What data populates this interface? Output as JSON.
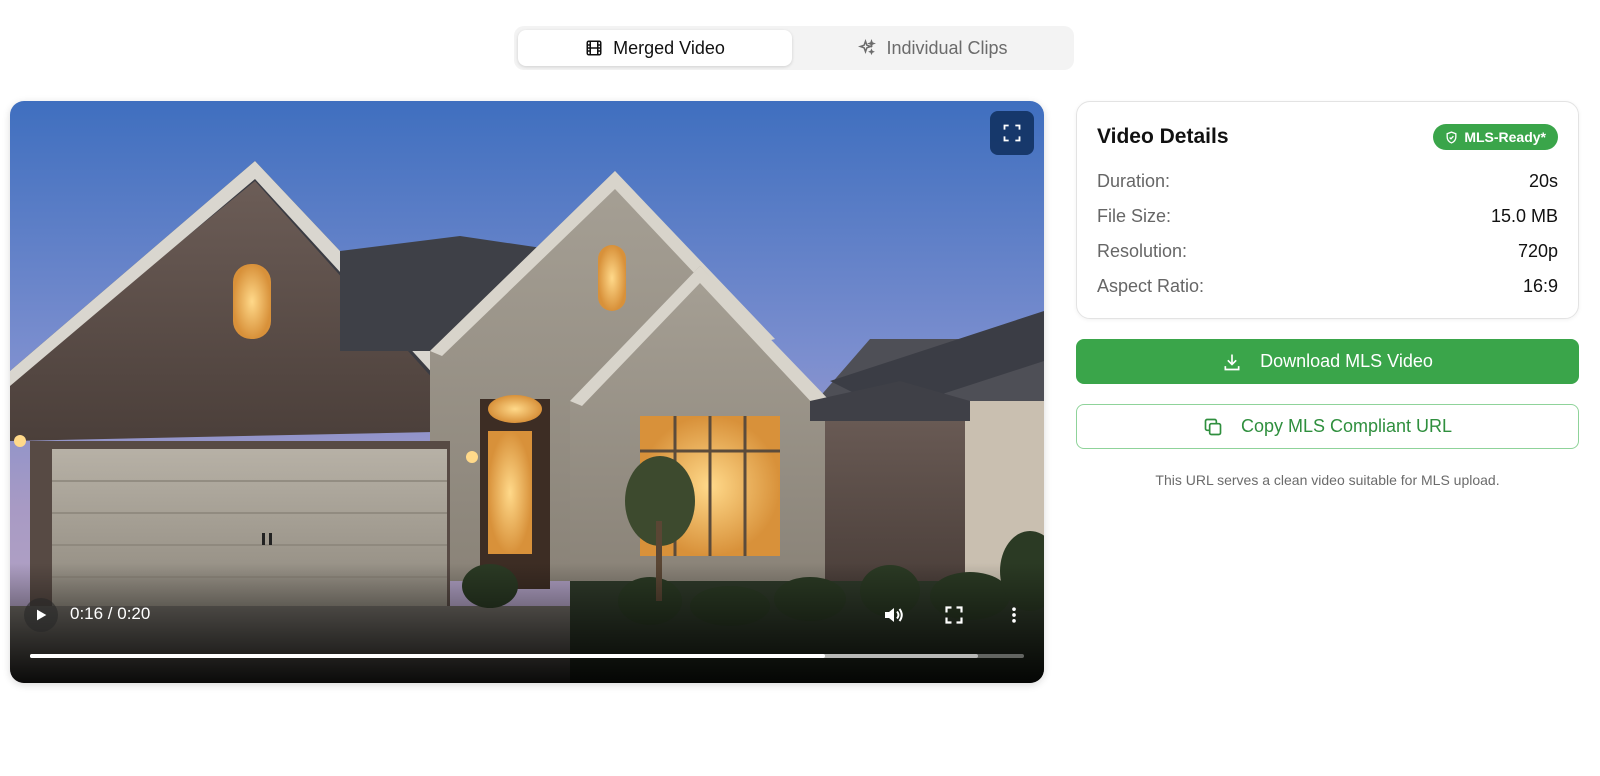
{
  "tabs": [
    {
      "label": "Merged Video",
      "icon": "film-icon",
      "active": true
    },
    {
      "label": "Individual Clips",
      "icon": "sparkles-icon",
      "active": false
    }
  ],
  "video": {
    "current_time": "0:16",
    "total_time": "0:20",
    "time_display": "0:16 / 0:20",
    "progress": 0.8,
    "buffered": 0.954
  },
  "details": {
    "title": "Video Details",
    "badge": "MLS-Ready*",
    "rows": [
      {
        "key": "Duration:",
        "value": "20s"
      },
      {
        "key": "File Size:",
        "value": "15.0 MB"
      },
      {
        "key": "Resolution:",
        "value": "720p"
      },
      {
        "key": "Aspect Ratio:",
        "value": "16:9"
      }
    ]
  },
  "actions": {
    "download_label": "Download MLS Video",
    "copy_label": "Copy MLS Compliant URL",
    "note": "This URL serves a clean video suitable for MLS upload."
  },
  "colors": {
    "accent_green": "#3aa54a",
    "copy_text_green": "#2f8f3e"
  }
}
